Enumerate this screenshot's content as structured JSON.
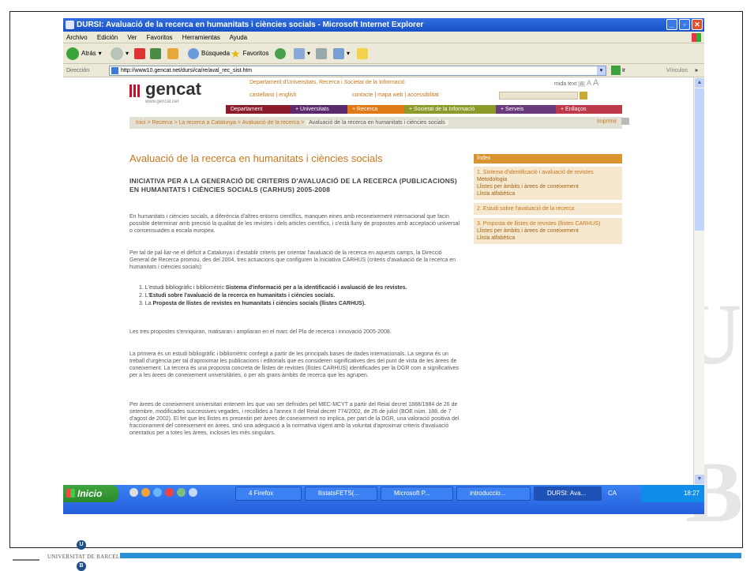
{
  "browser": {
    "title": "DURSI: Avaluació de la recerca en humanitats i ciències socials - Microsoft Internet Explorer",
    "menu": [
      "Archivo",
      "Edición",
      "Ver",
      "Favoritos",
      "Herramientas",
      "Ayuda"
    ],
    "toolbar": {
      "back": "Atrás",
      "search": "Búsqueda",
      "favorites": "Favoritos"
    },
    "address_label": "Dirección",
    "url": "http://www10.gencat.net/dursi/ca/re/aval_rec_sist.htm",
    "go_label": "Ir",
    "links_label": "Vínculos"
  },
  "site": {
    "logo": "gencat",
    "logo_url": "www.gencat.net",
    "department": "Departament d'Universitats, Recerca i Societat de la Informació",
    "mida_text": "mida text",
    "mida_sizes": [
      "A",
      "A",
      "A"
    ],
    "languages": "castellano | english",
    "contact_links": "contacte | mapa web | accessibilitat",
    "nav": [
      {
        "label": "Departament",
        "color": "#8a1c2c"
      },
      {
        "label": "Universitats",
        "color": "#5b2a6b"
      },
      {
        "label": "Recerca",
        "color": "#e07a16"
      },
      {
        "label": "Societat de la Informació",
        "color": "#8d9a2a"
      },
      {
        "label": "Serveis",
        "color": "#6a3b7c"
      },
      {
        "label": "Enllaços",
        "color": "#bc3a4a"
      }
    ],
    "breadcrumb": [
      "Inici",
      "Recerca",
      "La recerca a Catalunya",
      "Avaluació de la recerca"
    ],
    "breadcrumb_current": "Avaluació de la recerca en humanitats i ciències socials",
    "print": "Imprimir"
  },
  "content": {
    "page_title": "Avaluació de la recerca en humanitats i ciències socials",
    "initiative_title": "INICIATIVA PER A LA GENERACIÓ DE CRITERIS D'AVALUACIÓ DE LA RECERCA (PUBLICACIONS) EN HUMANITATS I CIÈNCIES SOCIALS (CARHUS) 2005-2008",
    "p1": "En humanitats i ciències socials, a diferència d'altres entorns científics, manquen eines amb reconeixement internacional que facin possible determinar amb precisió la qualitat de les revistes i dels articles científics, i s'està lluny de propostes amb acceptació universal o consensuades a escala europea.",
    "p2": "Per tal de pal·liar-ne el dèficit a Catalunya i d'establir criteris per orientar l'avaluació de la recerca en aquests camps, la Direcció General de Recerca promou, des del 2004, tres actuacions que configuren la iniciativa CARHUS (criteris d'avaluació de la recerca en humanitats i ciències socials):",
    "list": [
      {
        "n": "1.",
        "pre": "L'estudi bibliogràfic i bibliomètric ",
        "bold": "Sistema d'informació per a la identificació i avaluació de les revistes."
      },
      {
        "n": "2.",
        "pre": "L'",
        "bold": "Estudi sobre l'avaluació de la recerca en humanitats i ciències socials."
      },
      {
        "n": "3.",
        "pre": "La ",
        "bold": "Proposta de llistes de revistes en humanitats i ciències socials (llistes CARHUS)."
      }
    ],
    "p3": "Les tres propostes s'enriquiran, matisaran i ampliaran en el marc del Pla de recerca i innovació 2005-2008.",
    "p4": "La primera és un estudi bibliogràfic i bibliomètric confegit a partir de les principals bases de dades internacionals. La segona és un treball d'urgència per tal d'aproximar les publicacions i editorials que es consideren significatives des del punt de vista de les àrees de coneixement. La tercera és una proposta concreta de llistes de revistes (llistes CARHUS) identificades per la DGR com a significatives per a les àrees de coneixement universitàries, o per als grans àmbits de recerca que les agrupen.",
    "p5": "Per àrees de coneixement universitari entenem les que van ser definides pel MEC-MCYT a partir del Reial decret 1888/1984 de 26 de setembre, modificades successives vegades, i recollides a l'annex II del Reial decret 774/2002, de 26 de juliol (BOE núm. 188, de 7 d'agost de 2002). El fet que les llistes es presentin per àrees de coneixement no implica, per part de la DGR, una valoració positiva del fraccionament del coneixement en àrees, sinó una adequació a la normativa vigent amb la voluntat d'aproximar criteris d'avaluació orientatius per a totes les àrees, incloses les més singulars."
  },
  "index": {
    "header": "Índex",
    "sections": [
      {
        "title": "1. Sistema d'identificació i avaluació de revistes",
        "subs": [
          "Metodologia",
          "Llistes per àmbits i àrees de coneixement",
          "Llista alfabètica"
        ]
      },
      {
        "title": "2. Estudi sobre l'avaluació de la recerca",
        "subs": []
      },
      {
        "title": "3. Proposta de llistes de revistes (llistes CARHUS)",
        "subs": [
          "Llistes per àmbits i àrees de coneixement",
          "Llista alfabètica"
        ]
      }
    ]
  },
  "taskbar": {
    "start": "Inicio",
    "tasks": [
      "4 Firefox",
      "llistatsFETS(...",
      "Microsoft P...",
      "introduccio...",
      "DURSI: Ava..."
    ],
    "lang": "CA",
    "clock": "18:27"
  },
  "footer": {
    "university": "UNIVERSITAT DE BARCELONA",
    "monogram_top": "U",
    "monogram_bottom": "B"
  }
}
